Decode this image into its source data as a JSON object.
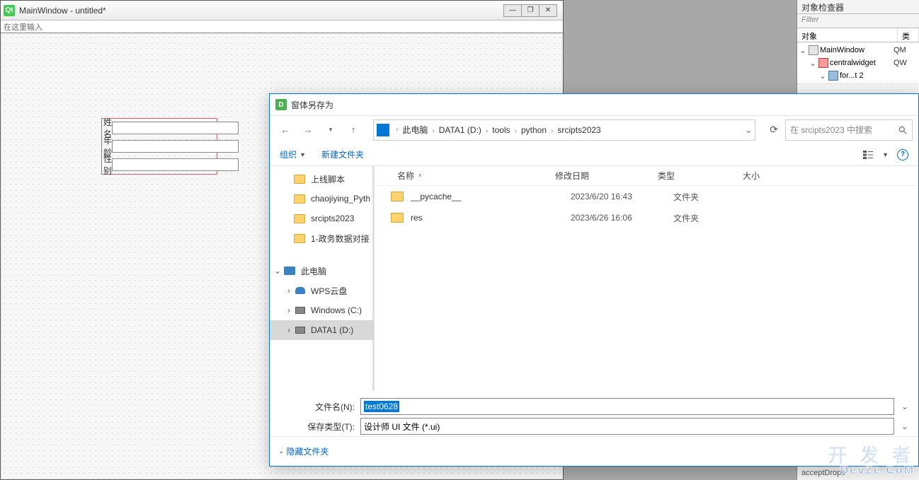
{
  "qt": {
    "title": "MainWindow - untitled*",
    "toolbar_hint": "在这里输入",
    "form": {
      "labels": [
        "姓名",
        "年龄",
        "性别"
      ],
      "values": [
        "",
        "",
        ""
      ]
    }
  },
  "inspector": {
    "title": "对象检查器",
    "filter_placeholder": "Filter",
    "col_object": "对象",
    "col_class": "类",
    "tree": [
      {
        "indent": 0,
        "name": "MainWindow",
        "klass": "QM",
        "icon": "window",
        "expanded": true
      },
      {
        "indent": 1,
        "name": "centralwidget",
        "klass": "QW",
        "icon": "widget",
        "expanded": true
      },
      {
        "indent": 2,
        "name": "for...t 2",
        "klass": "",
        "icon": "layout",
        "expanded": true
      }
    ],
    "bottom_text": "acceptDrops"
  },
  "dialog": {
    "title": "窗体另存为",
    "breadcrumbs": [
      "此电脑",
      "DATA1 (D:)",
      "tools",
      "python",
      "srcipts2023"
    ],
    "search_placeholder": "在 srcipts2023 中搜索",
    "toolbar": {
      "organize": "组织",
      "new_folder": "新建文件夹"
    },
    "tree": [
      {
        "label": "上线脚本",
        "type": "folder",
        "indent": 1
      },
      {
        "label": "chaojiying_Pyth",
        "type": "folder",
        "indent": 1
      },
      {
        "label": "srcipts2023",
        "type": "folder",
        "indent": 1
      },
      {
        "label": "1-政务数据对接",
        "type": "folder",
        "indent": 1
      },
      {
        "gap": true
      },
      {
        "label": "此电脑",
        "type": "pc",
        "indent": 0,
        "caret": "open"
      },
      {
        "label": "WPS云盘",
        "type": "cloud",
        "indent": 1,
        "caret": "closed"
      },
      {
        "label": "Windows (C:)",
        "type": "drive",
        "indent": 1,
        "caret": "closed"
      },
      {
        "label": "DATA1 (D:)",
        "type": "drive",
        "indent": 1,
        "caret": "closed",
        "selected": true
      }
    ],
    "list": {
      "col_name": "名称",
      "col_date": "修改日期",
      "col_type": "类型",
      "col_size": "大小",
      "rows": [
        {
          "name": "__pycache__",
          "date": "2023/6/20 16:43",
          "type": "文件夹",
          "size": ""
        },
        {
          "name": "res",
          "date": "2023/6/26 16:06",
          "type": "文件夹",
          "size": ""
        }
      ]
    },
    "file_name_label": "文件名(N):",
    "file_name_value": "test0628",
    "save_type_label": "保存类型(T):",
    "save_type_value": "设计师 UI 文件 (*.ui)",
    "hide_folders": "隐藏文件夹"
  },
  "watermark": {
    "line1": "开 发 者",
    "line2": "DevZe.CoM"
  }
}
